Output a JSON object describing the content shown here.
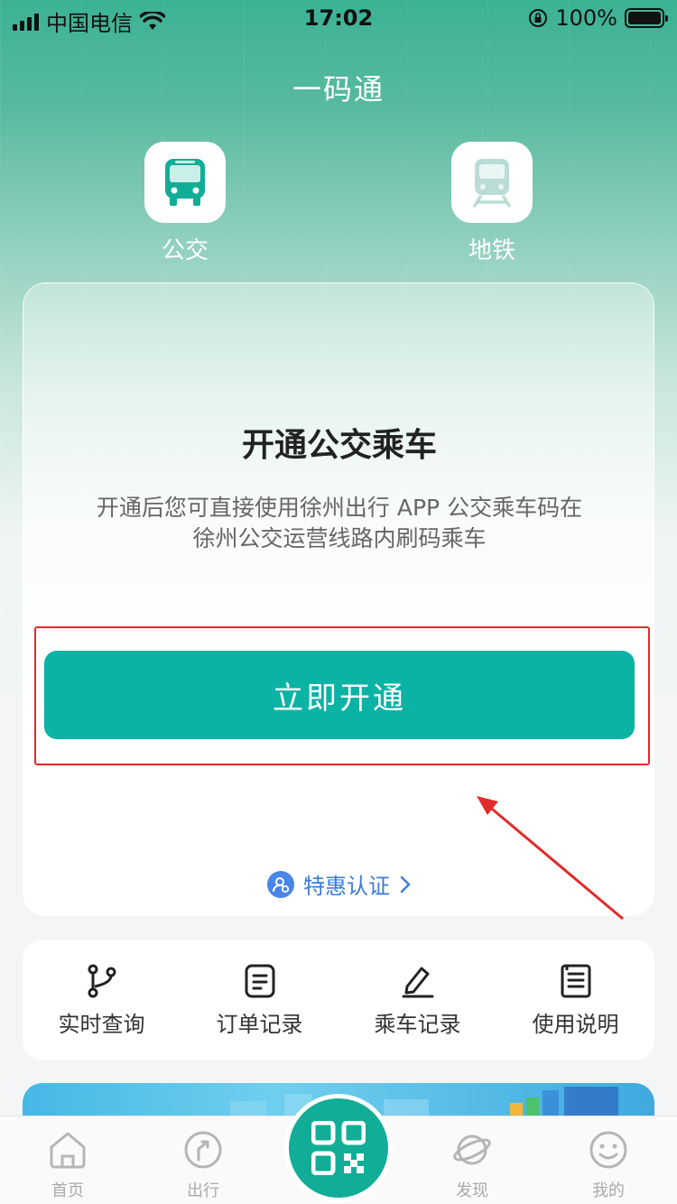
{
  "status_bar": {
    "carrier": "中国电信",
    "time": "17:02",
    "battery": "100%"
  },
  "header": {
    "title": "一码通"
  },
  "modes": [
    {
      "label": "公交",
      "icon": "bus-icon"
    },
    {
      "label": "地铁",
      "icon": "metro-icon"
    }
  ],
  "card": {
    "title": "开通公交乘车",
    "description": "开通后您可直接使用徐州出行 APP 公交乘车码在徐州公交运营线路内刷码乘车",
    "button_label": "立即开通",
    "discount_link": "特惠认证"
  },
  "quick_actions": [
    {
      "label": "实时查询",
      "icon": "route-icon"
    },
    {
      "label": "订单记录",
      "icon": "order-icon"
    },
    {
      "label": "乘车记录",
      "icon": "ride-record-icon"
    },
    {
      "label": "使用说明",
      "icon": "manual-icon"
    }
  ],
  "tab_bar": {
    "items": [
      {
        "label": "首页",
        "icon": "home-icon"
      },
      {
        "label": "出行",
        "icon": "travel-icon"
      },
      {
        "label": "",
        "icon": "qr-code-icon"
      },
      {
        "label": "发现",
        "icon": "planet-icon"
      },
      {
        "label": "我的",
        "icon": "smile-icon"
      }
    ]
  },
  "colors": {
    "brand": "#0bb3a5",
    "header_bg": "#3bb294",
    "link": "#3b7ad9",
    "highlight": "#e02b2b"
  }
}
